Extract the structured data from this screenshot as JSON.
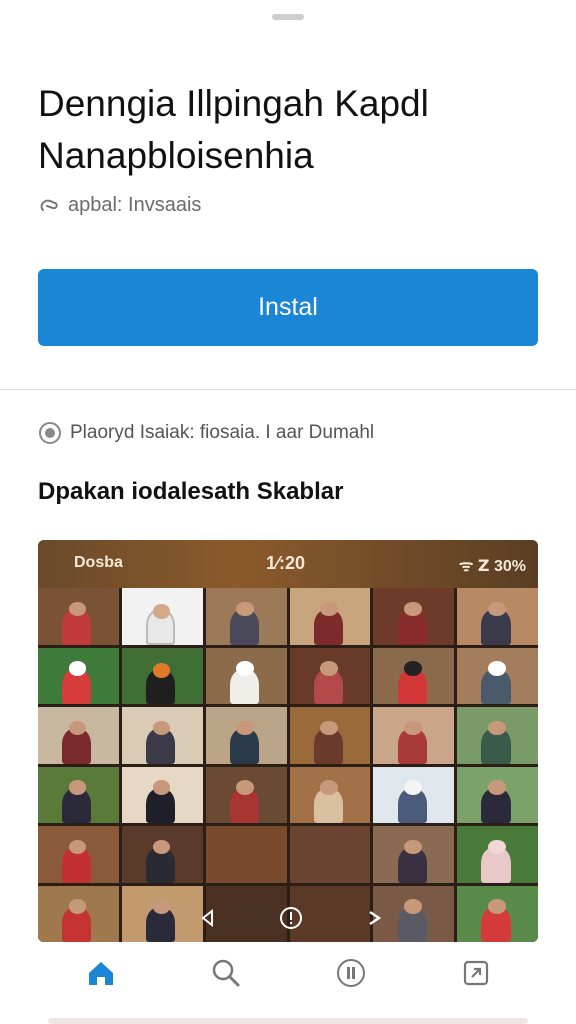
{
  "sheet": {
    "title_line1": "Denngia Illpingah Kapdl",
    "title_line2": "Nanapbloisenhia",
    "meta_text": "apbal: Invsaais",
    "install_label": "Instal",
    "info_text": "Plaoryd Isaiak: fiosaia. I aar Dumahl",
    "section_title": "Dpakan iodalesath Skablar"
  },
  "preview": {
    "status_left": "Dosba",
    "status_time": "1⁄:20",
    "status_right": "ᯤ 𝗭 30%",
    "nav_icons": [
      "back-icon",
      "alert-icon",
      "forward-icon"
    ]
  },
  "bottom_nav": {
    "items": [
      "home-icon",
      "search-icon",
      "pause-icon",
      "share-icon"
    ],
    "active": "home-icon"
  },
  "colors": {
    "install_button": "#1b86d6",
    "active_nav": "#1b86d6",
    "muted_text": "#6b6b6b"
  }
}
